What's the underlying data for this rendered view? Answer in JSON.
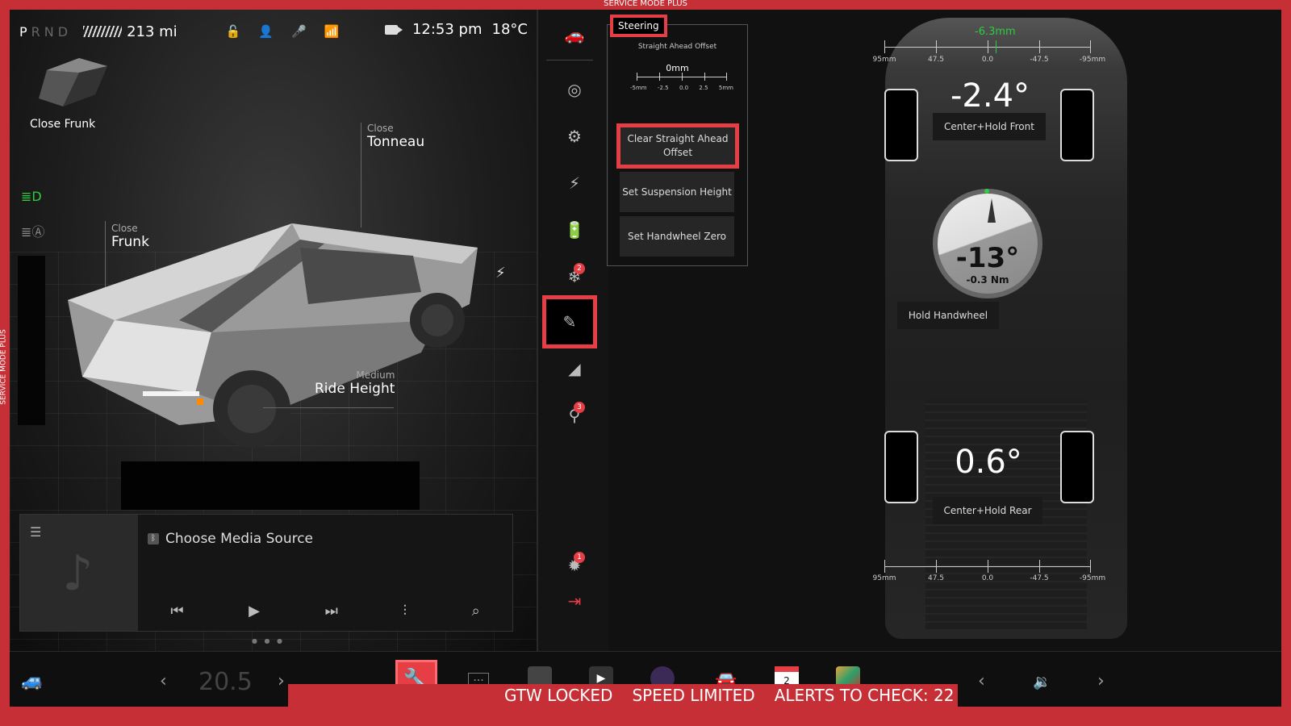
{
  "service_banner": "SERVICE MODE PLUS",
  "status": {
    "gear_p": "P",
    "gear_rnd": "RND",
    "range": "213 mi",
    "time": "12:53 pm",
    "temperature": "18°C"
  },
  "vehicle": {
    "frunk_thumb_label": "Close Frunk",
    "tonneau_small": "Close",
    "tonneau_big": "Tonneau",
    "frunk_small": "Close",
    "frunk_big": "Frunk",
    "ride_small": "Medium",
    "ride_big": "Ride Height"
  },
  "media": {
    "source": "Choose Media Source"
  },
  "nav": {
    "badge_climate": "2",
    "badge_safety": "3",
    "badge_bug": "1"
  },
  "steering": {
    "tab": "Steering",
    "offset_title": "Straight Ahead Offset",
    "offset_value": "0mm",
    "ruler_labels": [
      "-5mm",
      "-2.5",
      "0.0",
      "2.5",
      "5mm"
    ],
    "btn_clear": "Clear Straight Ahead Offset",
    "btn_suspension": "Set Suspension Height",
    "btn_handwheel": "Set Handwheel Zero"
  },
  "alignment": {
    "front_offset": "-6.3mm",
    "scale_labels": [
      "95mm",
      "47.5",
      "0.0",
      "-47.5",
      "-95mm"
    ],
    "front_angle": "-2.4°",
    "front_button": "Center+Hold Front",
    "handwheel_angle": "-13°",
    "handwheel_torque": "-0.3 Nm",
    "handwheel_button": "Hold Handwheel",
    "rear_angle": "0.6°",
    "rear_button": "Center+Hold Rear"
  },
  "taskbar": {
    "temp_setpoint": "20.5",
    "calendar_day": "2"
  },
  "alerts": {
    "gtw": "GTW LOCKED",
    "speed": "SPEED LIMITED",
    "count": "ALERTS TO CHECK: 22"
  },
  "colors": {
    "accent_red": "#e53e44",
    "green": "#2ecc40"
  }
}
